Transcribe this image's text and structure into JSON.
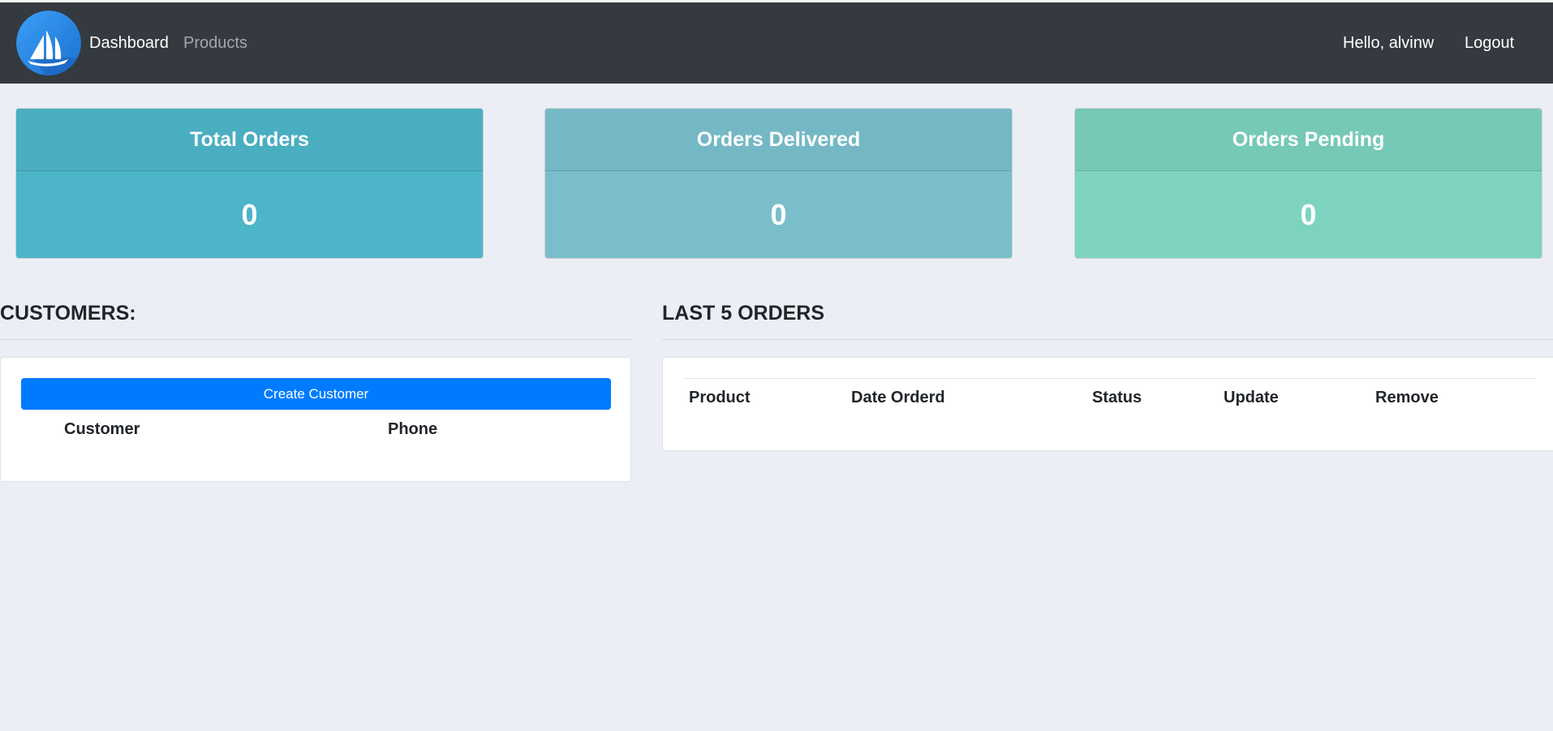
{
  "navbar": {
    "brand_icon": "sailboat-logo",
    "links": [
      "Dashboard",
      "Products"
    ],
    "greeting": "Hello, alvinw",
    "logout_label": "Logout",
    "background": "#343a40"
  },
  "stats": [
    {
      "title": "Total Orders",
      "value": "0",
      "color": "#4cb5c8"
    },
    {
      "title": "Orders Delivered",
      "value": "0",
      "color": "#7bbecb"
    },
    {
      "title": "Orders Pending",
      "value": "0",
      "color": "#7dd3c0"
    }
  ],
  "customers": {
    "heading": "CUSTOMERS:",
    "create_button_label": "Create Customer",
    "button_color": "#007bff",
    "columns": [
      "Customer",
      "Phone"
    ],
    "rows": []
  },
  "orders": {
    "heading": "LAST 5 ORDERS",
    "columns": [
      "Product",
      "Date Orderd",
      "Status",
      "Update",
      "Remove"
    ],
    "rows": []
  }
}
